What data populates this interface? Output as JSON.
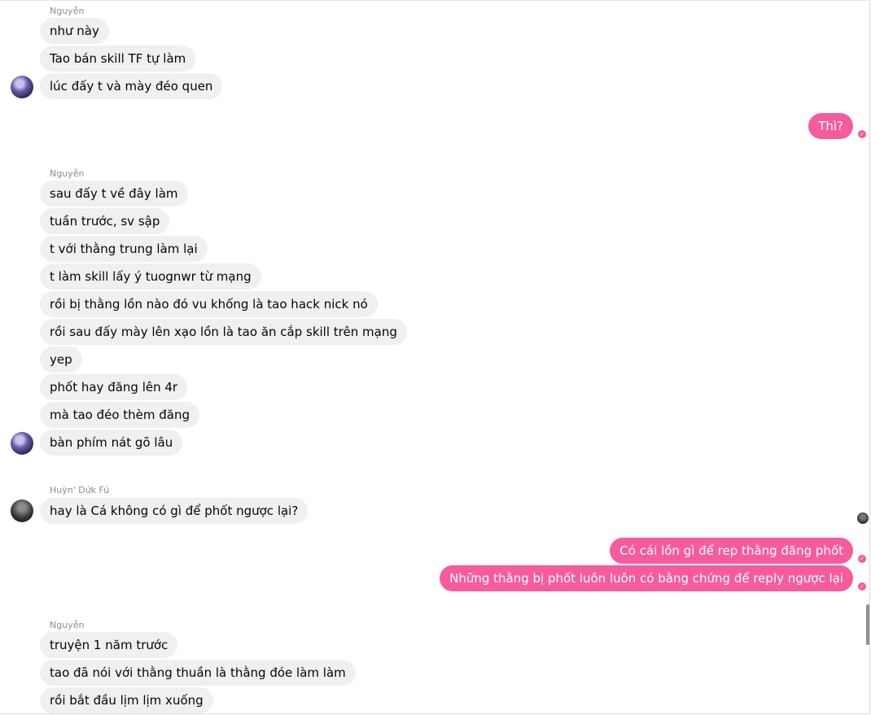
{
  "groups": [
    {
      "sender": "Nguyễn",
      "messages": [
        "như này",
        "Tao bán skill TF tự làm",
        "lúc đấy t và mày đéo quen"
      ]
    },
    {
      "outgoing": [
        "Thì?"
      ]
    },
    {
      "sender": "Nguyễn",
      "messages": [
        "sau đấy t về đây làm",
        "tuần trước, sv sập",
        "t với thằng trung làm lại",
        "t làm skill lấy ý tuognwr từ mạng",
        "rồi bị thằng lồn nào đó vu khống là tao hack nick nó",
        "rồi sau đấy mày lên xạo lồn là tao ăn cắp skill trên mạng",
        "yep",
        "phốt hay đăng lên 4r",
        "mà tao đéo thèm đăng",
        "bàn phím nát gõ lâu"
      ]
    },
    {
      "sender": "Huỳn' Dứk Fú",
      "messages": [
        "hay là Cá không có gì để phốt ngược lại?"
      ]
    },
    {
      "outgoing": [
        "Có cái lồn gì để rep thằng đăng phốt",
        "Những thằng bị phốt luôn luôn có bằng chứng để reply ngược lại"
      ]
    },
    {
      "sender": "Nguyễn",
      "messages": [
        "truyện 1 năm trước",
        "tao đã nói với thằng thuần là thằng đóe làm làm",
        "rồi bắt đầu lịm lịm xuống"
      ]
    }
  ],
  "colors": {
    "outgoing_bubble": "#f65c9d",
    "incoming_bubble": "#f0f0f0",
    "sender_name": "#8a8d91"
  },
  "icons": {
    "seen": "check-circle-icon",
    "read_receipt": "avatar"
  }
}
